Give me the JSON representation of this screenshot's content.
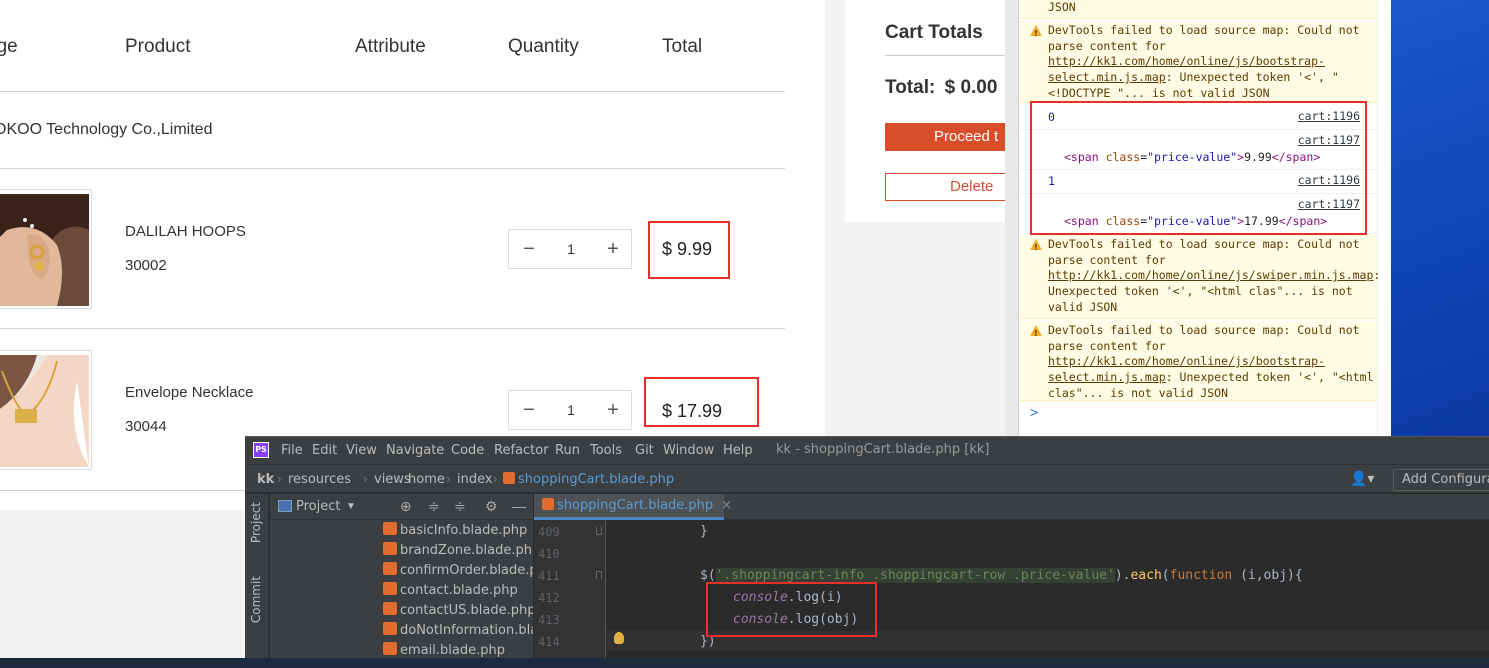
{
  "cart": {
    "headers": [
      "age",
      "Product",
      "Attribute",
      "Quantity",
      "Total"
    ],
    "shop_name": "OKOO Technology Co.,Limited",
    "items": [
      {
        "name": "DALILAH HOOPS",
        "code": "30002",
        "qty": "1",
        "total": "$ 9.99"
      },
      {
        "name": "Envelope Necklace",
        "code": "30044",
        "qty": "1",
        "total": "$ 17.99"
      }
    ],
    "minus": "−",
    "plus": "+"
  },
  "totals": {
    "title": "Cart Totals",
    "total_label": "Total:",
    "total_value": "$ 0.00",
    "proceed_label": "Proceed t",
    "delete_label": "Delete"
  },
  "console": {
    "top_fragment": "JSON",
    "warnings": [
      {
        "pre": "DevTools failed to load source map: Could not parse content for ",
        "link": "http://kk1.com/home/online/js/bootstrap-select.min.js.map",
        "post": ": Unexpected token '<', \"<!DOCTYPE \"... is not valid JSON"
      },
      {
        "pre": "DevTools failed to load source map: Could not parse content for ",
        "link": "http://kk1.com/home/online/js/swiper.min.js.map",
        "post": ": Unexpected token '<', \"<html clas\"... is not valid JSON"
      },
      {
        "pre": "DevTools failed to load source map: Could not parse content for ",
        "link": "http://kk1.com/home/online/js/bootstrap-select.min.js.map",
        "post": ": Unexpected token '<', \"<html clas\"... is not valid JSON"
      }
    ],
    "logs": [
      {
        "index": "0",
        "src1": "cart:1196",
        "src2": "cart:1197",
        "span_open": "<span",
        "attr": "class",
        "attr_val": "\"price-value\"",
        "text": "9.99",
        "span_close": "</span>"
      },
      {
        "index": "1",
        "src1": "cart:1196",
        "src2": "cart:1197",
        "span_open": "<span",
        "attr": "class",
        "attr_val": "\"price-value\"",
        "text": "17.99",
        "span_close": "</span>"
      }
    ],
    "prompt": ">"
  },
  "ide": {
    "logo": "PS",
    "menu": [
      "File",
      "Edit",
      "View",
      "Navigate",
      "Code",
      "Refactor",
      "Run",
      "Tools",
      "Git",
      "Window",
      "Help"
    ],
    "window_title": "kk - shoppingCart.blade.php [kk]",
    "breadcrumbs": [
      "kk",
      "resources",
      "views",
      "home",
      "index",
      "shoppingCart.blade.php"
    ],
    "add_config": "Add Configurat",
    "side_labels": [
      "Project",
      "Commit"
    ],
    "project_title": "Project",
    "files": [
      "basicInfo.blade.php",
      "brandZone.blade.php",
      "confirmOrder.blade.php",
      "contact.blade.php",
      "contactUS.blade.php",
      "doNotInformation.blade.php",
      "email.blade.php"
    ],
    "tab": "shoppingCart.blade.php",
    "line_numbers": [
      "409",
      "410",
      "411",
      "412",
      "413",
      "414"
    ],
    "code": {
      "l409": "}",
      "l411_a": "$(",
      "l411_str": "'.shoppingcart-info .shoppingcart-row .price-value'",
      "l411_b": ").",
      "l411_each": "each",
      "l411_c": "(",
      "l411_fn": "function",
      "l411_d": " (i,obj){",
      "console": "console",
      "log_i": ".log(i)",
      "log_obj": ".log(obj)",
      "l414": "})"
    }
  }
}
